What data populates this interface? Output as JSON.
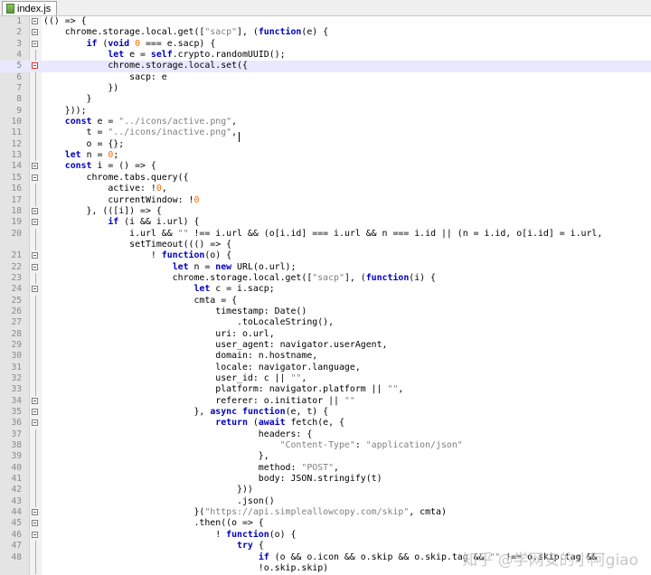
{
  "tab": {
    "label": "index.js"
  },
  "watermark": "知乎 @学网安的小阿giao",
  "lines": [
    {
      "n": "1",
      "t": "(() => {"
    },
    {
      "n": "2",
      "t": "    chrome.storage.local.get([\"sacp\"], (function(e) {"
    },
    {
      "n": "3",
      "t": "        if (void 0 === e.sacp) {"
    },
    {
      "n": "4",
      "t": "            let e = self.crypto.randomUUID();"
    },
    {
      "n": "5",
      "t": "            chrome.storage.local.set({"
    },
    {
      "n": "6",
      "t": "                sacp: e"
    },
    {
      "n": "7",
      "t": "            })"
    },
    {
      "n": "8",
      "t": "        }"
    },
    {
      "n": "9",
      "t": "    }));"
    },
    {
      "n": "10",
      "t": "    const e = \"../icons/active.png\","
    },
    {
      "n": "11",
      "t": "        t = \"../icons/inactive.png\","
    },
    {
      "n": "12",
      "t": "        o = {};"
    },
    {
      "n": "13",
      "t": "    let n = 0;"
    },
    {
      "n": "14",
      "t": "    const i = () => {"
    },
    {
      "n": "15",
      "t": "        chrome.tabs.query({"
    },
    {
      "n": "16",
      "t": "            active: !0,"
    },
    {
      "n": "17",
      "t": "            currentWindow: !0"
    },
    {
      "n": "18",
      "t": "        }, (([i]) => {"
    },
    {
      "n": "19",
      "t": "            if (i && i.url) {"
    },
    {
      "n": "20",
      "t": "                i.url && \"\" !== i.url && (o[i.id] === i.url && n === i.id || (n = i.id, o[i.id] = i.url,"
    },
    {
      "n": "",
      "t": "                setTimeout((() => {"
    },
    {
      "n": "21",
      "t": "                    ! function(o) {"
    },
    {
      "n": "22",
      "t": "                        let n = new URL(o.url);"
    },
    {
      "n": "23",
      "t": "                        chrome.storage.local.get([\"sacp\"], (function(i) {"
    },
    {
      "n": "24",
      "t": "                            let c = i.sacp;"
    },
    {
      "n": "25",
      "t": "                            cmta = {"
    },
    {
      "n": "26",
      "t": "                                timestamp: Date()"
    },
    {
      "n": "27",
      "t": "                                    .toLocaleString(),"
    },
    {
      "n": "28",
      "t": "                                uri: o.url,"
    },
    {
      "n": "29",
      "t": "                                user_agent: navigator.userAgent,"
    },
    {
      "n": "30",
      "t": "                                domain: n.hostname,"
    },
    {
      "n": "31",
      "t": "                                locale: navigator.language,"
    },
    {
      "n": "32",
      "t": "                                user_id: c || \"\","
    },
    {
      "n": "33",
      "t": "                                platform: navigator.platform || \"\","
    },
    {
      "n": "34",
      "t": "                                referer: o.initiator || \"\""
    },
    {
      "n": "35",
      "t": "                            }, async function(e, t) {"
    },
    {
      "n": "36",
      "t": "                                return (await fetch(e, {"
    },
    {
      "n": "37",
      "t": "                                        headers: {"
    },
    {
      "n": "38",
      "t": "                                            \"Content-Type\": \"application/json\""
    },
    {
      "n": "39",
      "t": "                                        },"
    },
    {
      "n": "40",
      "t": "                                        method: \"POST\","
    },
    {
      "n": "41",
      "t": "                                        body: JSON.stringify(t)"
    },
    {
      "n": "42",
      "t": "                                    }))"
    },
    {
      "n": "43",
      "t": "                                    .json()"
    },
    {
      "n": "44",
      "t": "                            }(\"https://api.simpleallowcopy.com/skip\", cmta)"
    },
    {
      "n": "45",
      "t": "                            .then((o => {"
    },
    {
      "n": "46",
      "t": "                                ! function(o) {"
    },
    {
      "n": "47",
      "t": "                                    try {"
    },
    {
      "n": "48",
      "t": "                                        if (o && o.icon && o.skip && o.skip.tag && \"\" !== o.skip.tag &&"
    },
    {
      "n": "",
      "t": "                                        !o.skip.skip)"
    }
  ]
}
